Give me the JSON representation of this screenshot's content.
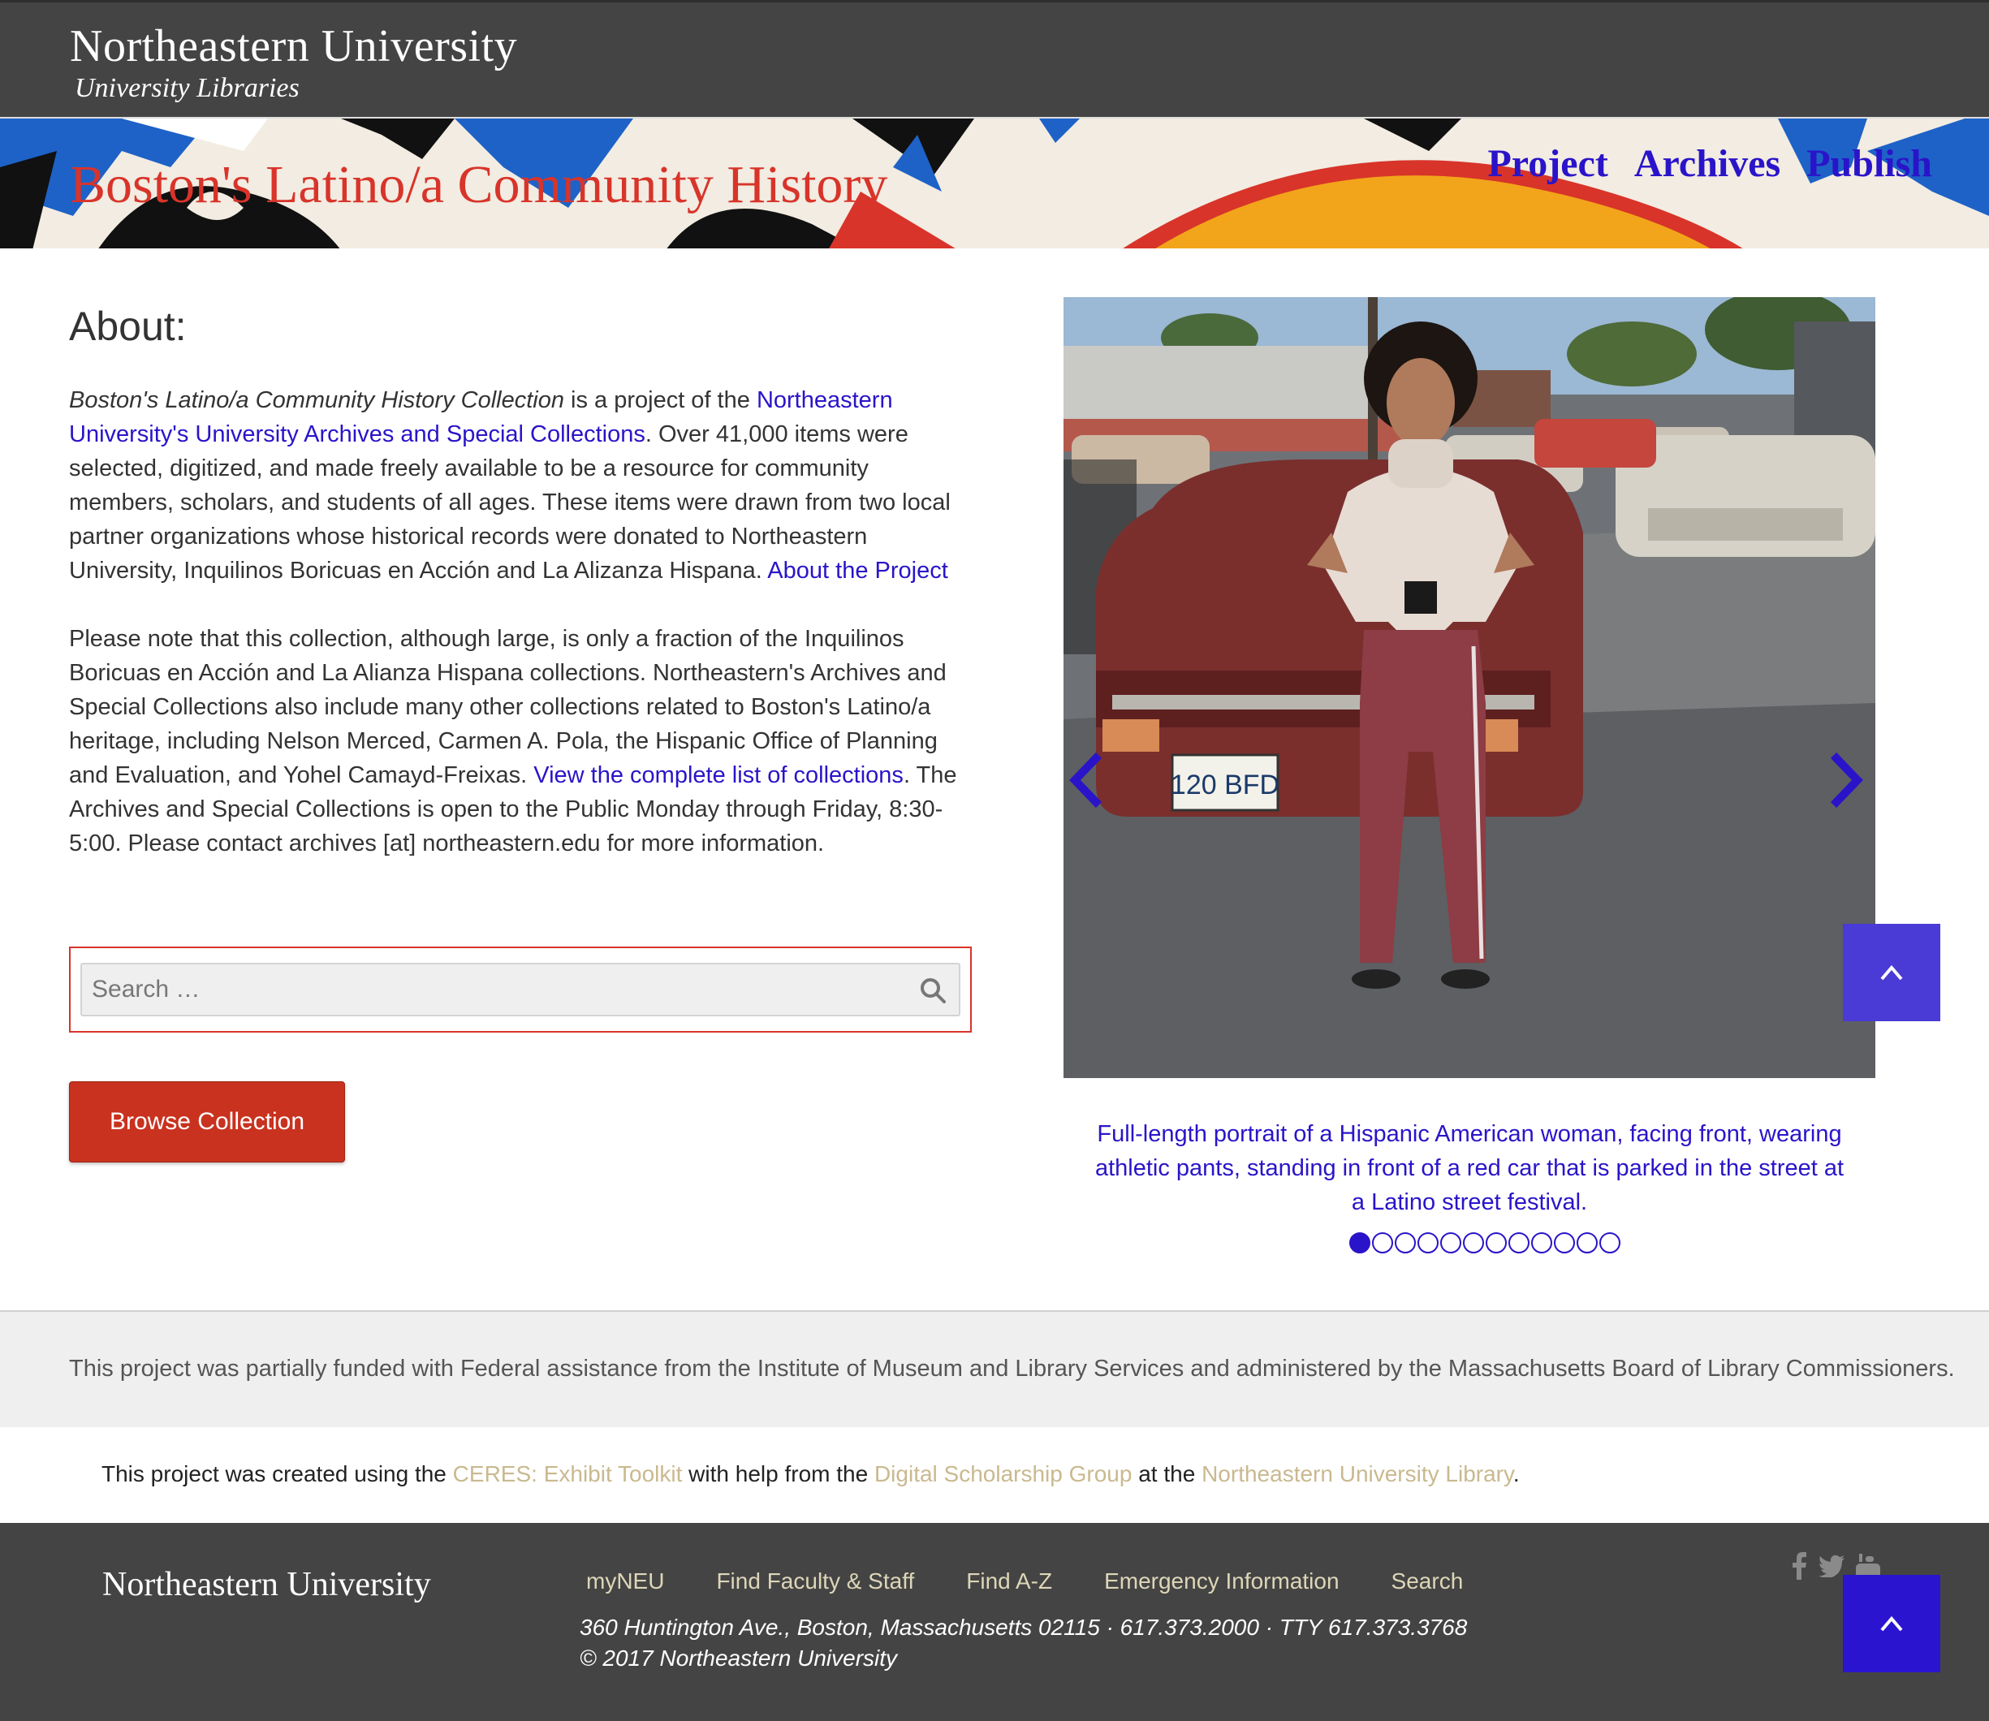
{
  "header": {
    "org_name": "Northeastern University",
    "org_sub": "University Libraries"
  },
  "banner": {
    "site_title": "Boston's Latino/a Community History",
    "nav": [
      "Project",
      "Archives",
      "Publish"
    ]
  },
  "about": {
    "heading": "About:",
    "p1_title": "Boston's Latino/a Community History Collection",
    "p1_a": " is a project of the ",
    "p1_link1": "Northeastern University's University Archives and Special Collections",
    "p1_b": ".  Over 41,000 items were selected, digitized, and made freely available to be a resource for community members, scholars, and students of all ages.  These items were drawn from two local partner organizations whose historical records were donated to Northeastern University, Inquilinos Boricuas en Acción and La Alizanza Hispana. ",
    "p1_link2": "About the Project",
    "p2_a": "Please note that this collection, although large, is only a fraction of the Inquilinos Boricuas en Acción and La Alianza Hispana collections.  Northeastern's Archives and Special Collections also include many other collections related to Boston's Latino/a heritage, including Nelson Merced, Carmen A. Pola, the Hispanic Office of Planning and Evaluation, and Yohel Camayd-Freixas.  ",
    "p2_link": "View the complete list of collections",
    "p2_b": ". The Archives and Special Collections is open to the Public Monday through Friday, 8:30-5:00.  Please contact archives [at] northeastern.edu for more information."
  },
  "search": {
    "placeholder": "Search …"
  },
  "browse_button": "Browse Collection",
  "carousel": {
    "plate": "120 BFD",
    "caption": "Full-length portrait of a Hispanic American woman, facing front, wearing athletic pants, standing in front of a red car that is parked in the street at a Latino street festival.",
    "slide_count": 12,
    "active_slide": 1
  },
  "funding": "This project was partially funded with Federal assistance from the Institute of Museum and Library Services and administered by the Massachusetts Board of Library Commissioners.",
  "credits": {
    "a": "This project was created using the ",
    "link1": "CERES: Exhibit Toolkit",
    "b": " with help from the ",
    "link2": "Digital Scholarship Group",
    "c": " at the ",
    "link3": "Northeastern University Library",
    "d": "."
  },
  "footer": {
    "org_name": "Northeastern University",
    "links": [
      "myNEU",
      "Find Faculty & Staff",
      "Find A-Z",
      "Emergency Information",
      "Search"
    ],
    "address": "360 Huntington Ave., Boston, Massachusetts 02115 · 617.373.2000 · TTY 617.373.3768",
    "copyright": "© 2017 Northeastern University",
    "social_icons": [
      "facebook-icon",
      "twitter-icon",
      "youtube-icon"
    ]
  },
  "colors": {
    "accent_blue": "#2a14c9",
    "brand_red": "#d8342a",
    "button_red": "#c8321f",
    "topbar_gray": "#444444"
  }
}
